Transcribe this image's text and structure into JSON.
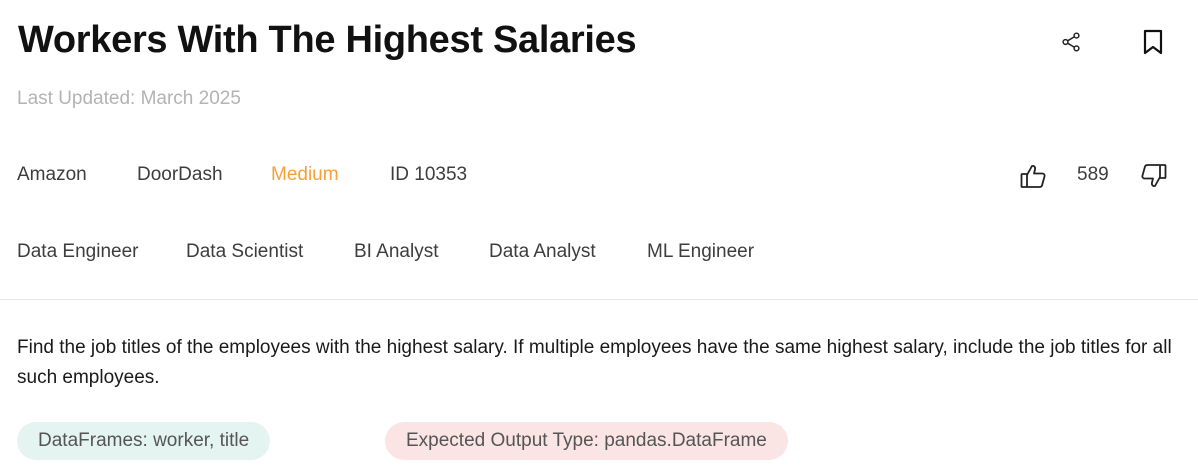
{
  "problem": {
    "title": "Workers With The Highest Salaries",
    "last_updated": "Last Updated: March 2025",
    "companies": [
      "Amazon",
      "DoorDash"
    ],
    "difficulty": "Medium",
    "id_label": "ID 10353",
    "votes": "589",
    "roles": [
      "Data Engineer",
      "Data Scientist",
      "BI Analyst",
      "Data Analyst",
      "ML Engineer"
    ],
    "description": "Find the job titles of the employees with the highest salary. If multiple employees have the same highest salary, include the job titles for all such employees.",
    "dataframes_chip": "DataFrames: worker, title",
    "output_chip": "Expected Output Type: pandas.DataFrame"
  },
  "icons": {
    "share": "share-icon",
    "bookmark": "bookmark-icon",
    "upvote": "thumbs-up-icon",
    "downvote": "thumbs-down-icon"
  },
  "colors": {
    "difficulty_medium": "#f5a03a",
    "dataframes_chip_bg": "#e3f4f1",
    "output_chip_bg": "#fbe4e4",
    "muted_text": "#b3b3b3"
  }
}
